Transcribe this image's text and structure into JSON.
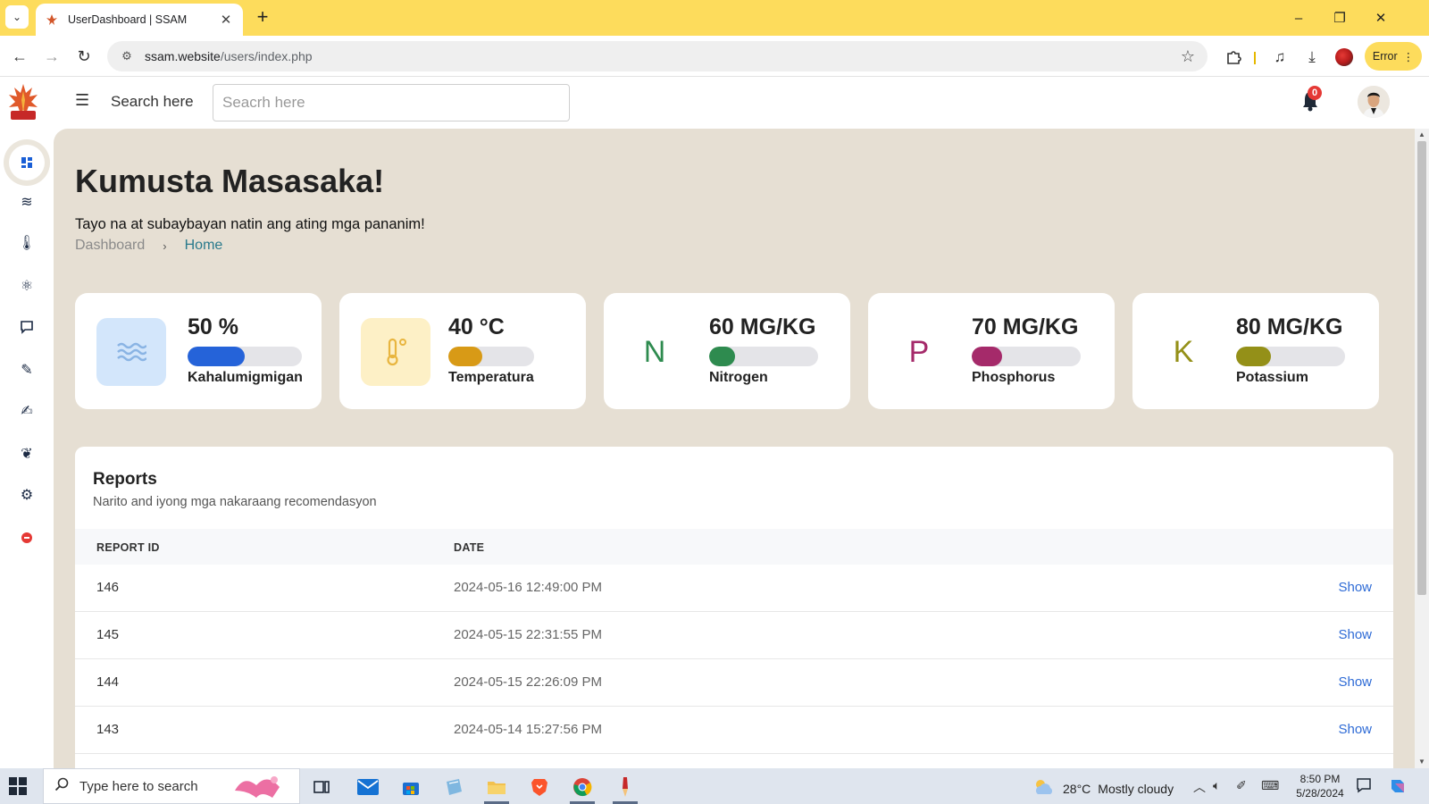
{
  "browser": {
    "tab_title": "UserDashboard | SSAM",
    "url_host": "ssam.website",
    "url_path": "/users/index.php",
    "error_label": "Error"
  },
  "header": {
    "search_label": "Search here",
    "search_placeholder": "Seacrh here",
    "notification_count": "0"
  },
  "page": {
    "title": "Kumusta Masasaka!",
    "subtitle": "Tayo na at subaybayan natin ang ating mga pananim!",
    "breadcrumb": [
      "Dashboard",
      "Home"
    ]
  },
  "cards": [
    {
      "value": "50 %",
      "label": "Kahalumigmigan",
      "icon": "water-waves-icon",
      "fill": 0.5,
      "color": "#2563d9",
      "icon_bg": "#d3e6fb"
    },
    {
      "value": "40 °C",
      "label": "Temperatura",
      "icon": "thermometer-icon",
      "fill": 0.4,
      "color": "#d89a16",
      "icon_bg": "#fdf0c6"
    },
    {
      "value": "60 MG/KG",
      "letter": "N",
      "label": "Nitrogen",
      "fill": 0.24,
      "color": "#2e8b4f"
    },
    {
      "value": "70 MG/KG",
      "letter": "P",
      "label": "Phosphorus",
      "fill": 0.28,
      "color": "#a52a6a"
    },
    {
      "value": "80 MG/KG",
      "letter": "K",
      "label": "Potassium",
      "fill": 0.32,
      "color": "#949018"
    }
  ],
  "reports": {
    "title": "Reports",
    "subtitle": "Narito and iyong mga nakaraang recomendasyon",
    "columns": [
      "REPORT ID",
      "DATE"
    ],
    "action_label": "Show",
    "rows": [
      {
        "id": "146",
        "date": "2024-05-16 12:49:00 PM"
      },
      {
        "id": "145",
        "date": "2024-05-15 22:31:55 PM"
      },
      {
        "id": "144",
        "date": "2024-05-15 22:26:09 PM"
      },
      {
        "id": "143",
        "date": "2024-05-14 15:27:56 PM"
      }
    ]
  },
  "sidebar": {
    "items": [
      "dashboard-icon",
      "humidity-icon",
      "temperature-icon",
      "nutrients-icon",
      "chat-icon",
      "edit-report-icon",
      "edit-file-icon",
      "leaf-icon",
      "settings-icon",
      "logout-icon"
    ]
  },
  "taskbar": {
    "search_placeholder": "Type here to search",
    "weather_temp": "28°C",
    "weather_desc": "Mostly cloudy",
    "time": "8:50 PM",
    "date": "5/28/2024"
  }
}
